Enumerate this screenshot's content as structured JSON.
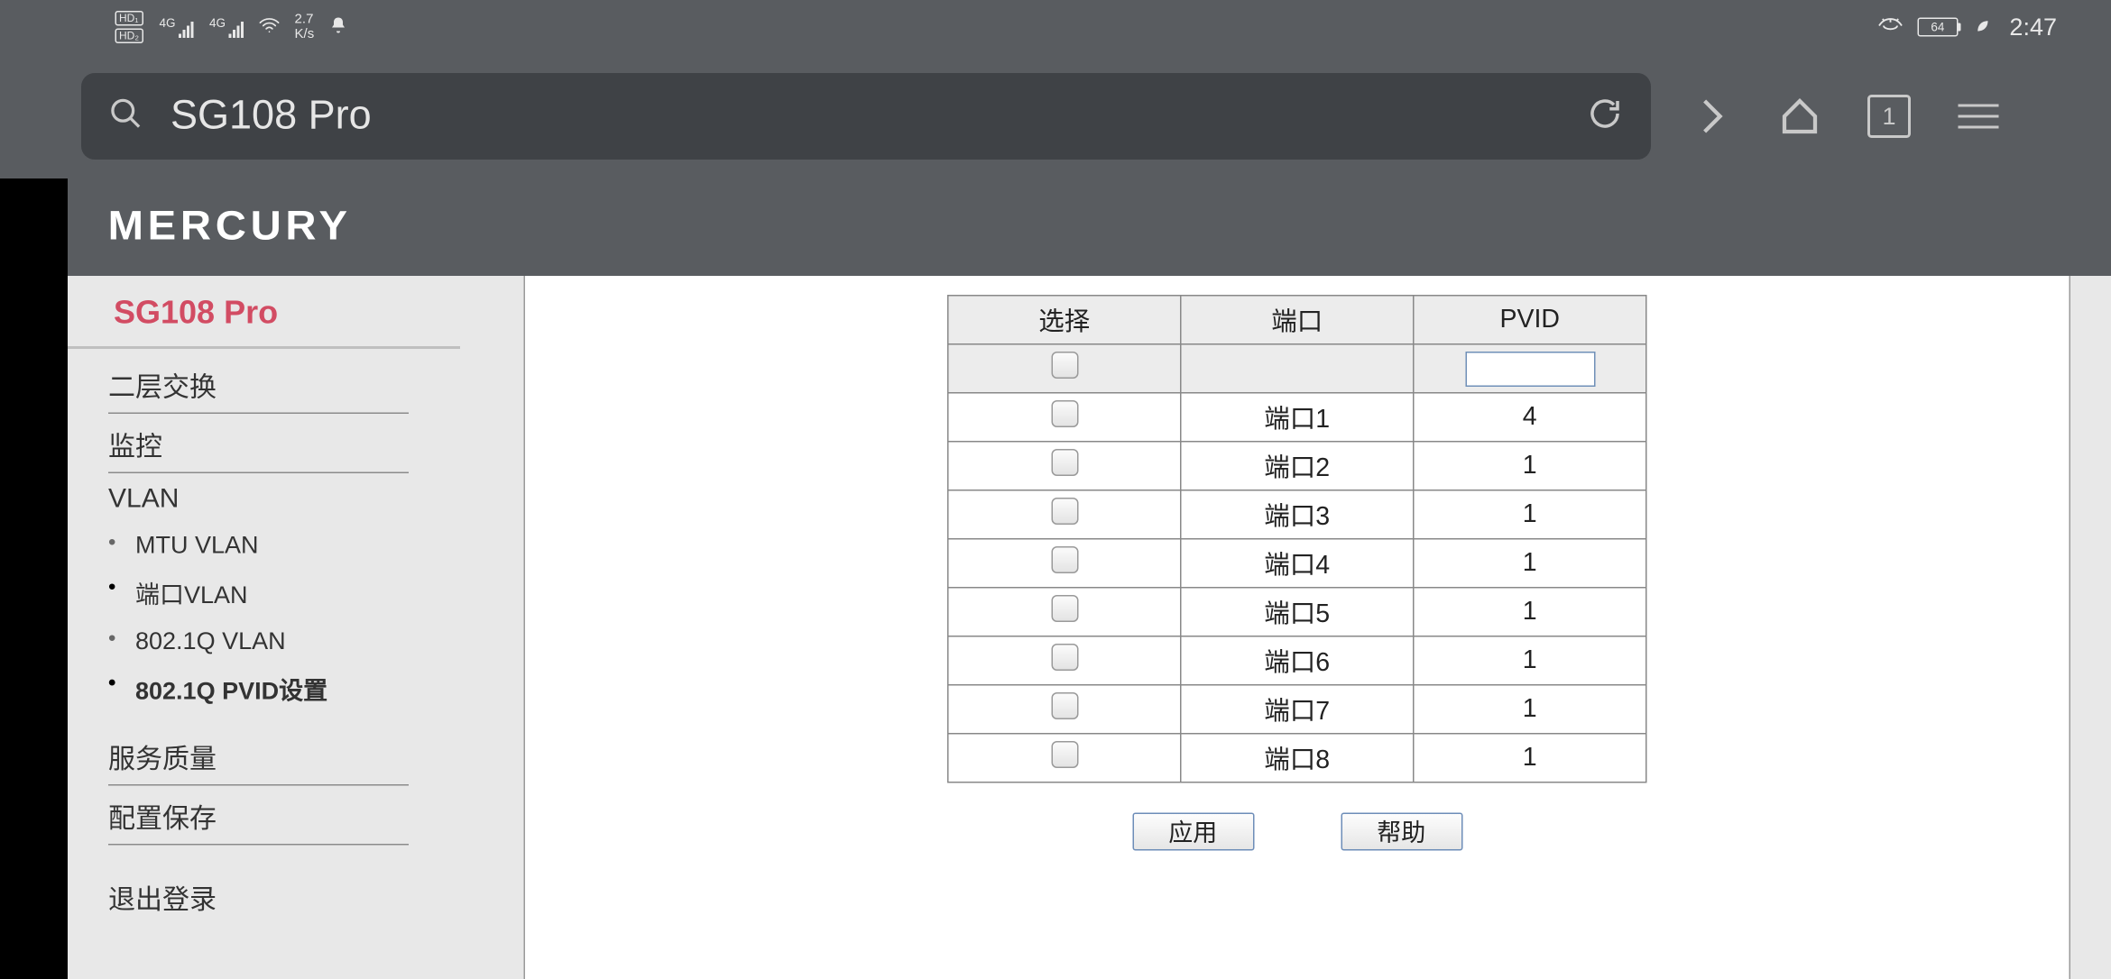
{
  "status": {
    "speed_value": "2.7",
    "speed_unit": "K/s",
    "sig_label": "4G",
    "battery_pct": "64",
    "clock": "2:47"
  },
  "browser": {
    "page_title": "SG108 Pro",
    "tab_count": "1"
  },
  "brand": {
    "logotype": "MERCURY",
    "product": "SG108 Pro"
  },
  "sidebar": {
    "items": [
      {
        "label": "二层交换",
        "level": 1
      },
      {
        "label": "监控",
        "level": 1
      },
      {
        "label": "VLAN",
        "level": 1
      },
      {
        "label": "MTU VLAN",
        "level": 2
      },
      {
        "label": "端口VLAN",
        "level": 2
      },
      {
        "label": "802.1Q VLAN",
        "level": 2
      },
      {
        "label": "802.1Q PVID设置",
        "level": 2,
        "active": true
      },
      {
        "label": "服务质量",
        "level": 1
      },
      {
        "label": "配置保存",
        "level": 1
      },
      {
        "label": "退出登录",
        "level": 1
      }
    ]
  },
  "table": {
    "headers": {
      "select": "选择",
      "port": "端口",
      "pvid": "PVID"
    },
    "input_row": {
      "pvid_value": ""
    },
    "rows": [
      {
        "port": "端口1",
        "pvid": "4"
      },
      {
        "port": "端口2",
        "pvid": "1"
      },
      {
        "port": "端口3",
        "pvid": "1"
      },
      {
        "port": "端口4",
        "pvid": "1"
      },
      {
        "port": "端口5",
        "pvid": "1"
      },
      {
        "port": "端口6",
        "pvid": "1"
      },
      {
        "port": "端口7",
        "pvid": "1"
      },
      {
        "port": "端口8",
        "pvid": "1"
      }
    ]
  },
  "buttons": {
    "apply": "应用",
    "help": "帮助"
  }
}
